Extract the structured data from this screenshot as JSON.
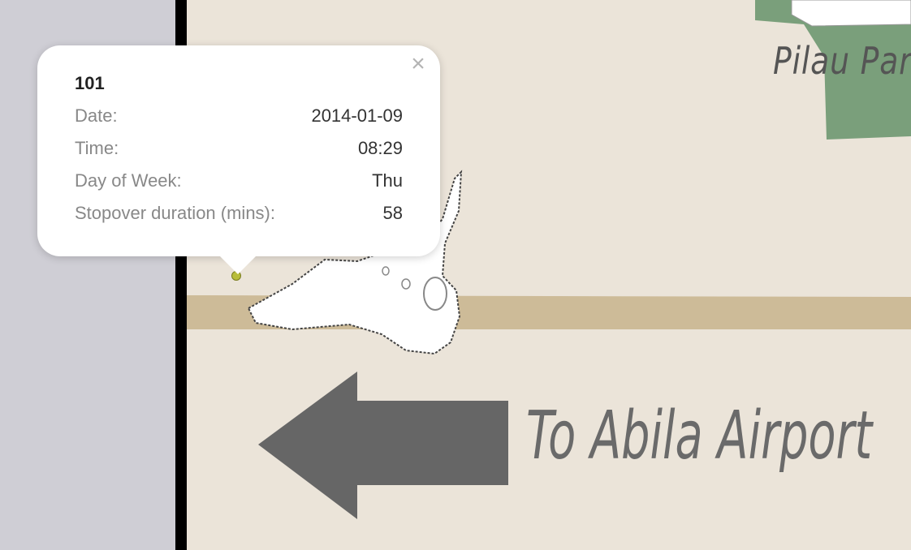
{
  "map": {
    "labels": {
      "park": "Pilau Park",
      "airport": "To Abila Airport"
    },
    "colors": {
      "background": "#ebe4d9",
      "side_panel": "#cfced5",
      "border": "#000000",
      "road": "#cdbb98",
      "park": "#7a9f7b",
      "arrow": "#666666",
      "marker": "#b8bd3a"
    }
  },
  "popup": {
    "title": "101",
    "close_icon": "close-icon",
    "rows": [
      {
        "label": "Date:",
        "value": "2014-01-09"
      },
      {
        "label": "Time:",
        "value": "08:29"
      },
      {
        "label": "Day of Week:",
        "value": "Thu"
      },
      {
        "label": "Stopover duration (mins):",
        "value": "58"
      }
    ]
  }
}
